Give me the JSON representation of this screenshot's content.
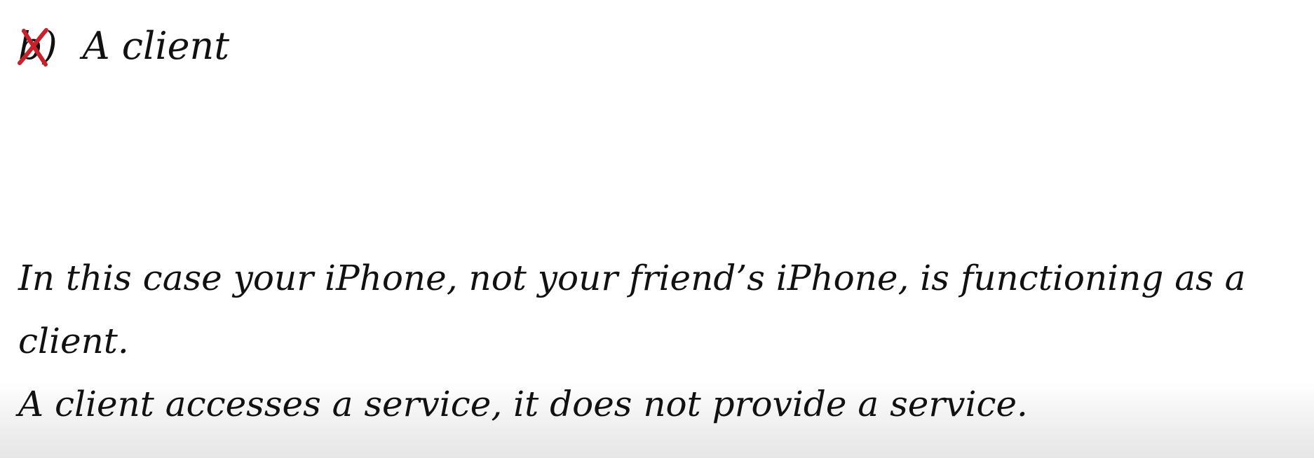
{
  "option": {
    "marker": "b)",
    "label": "A client",
    "result_icon": "cross-icon",
    "result_color": "#c8212b"
  },
  "explanation": {
    "lines": [
      "In this case your iPhone, not your friend’s iPhone, is functioning as a client.",
      "A client accesses a service, it does not provide a service."
    ]
  }
}
